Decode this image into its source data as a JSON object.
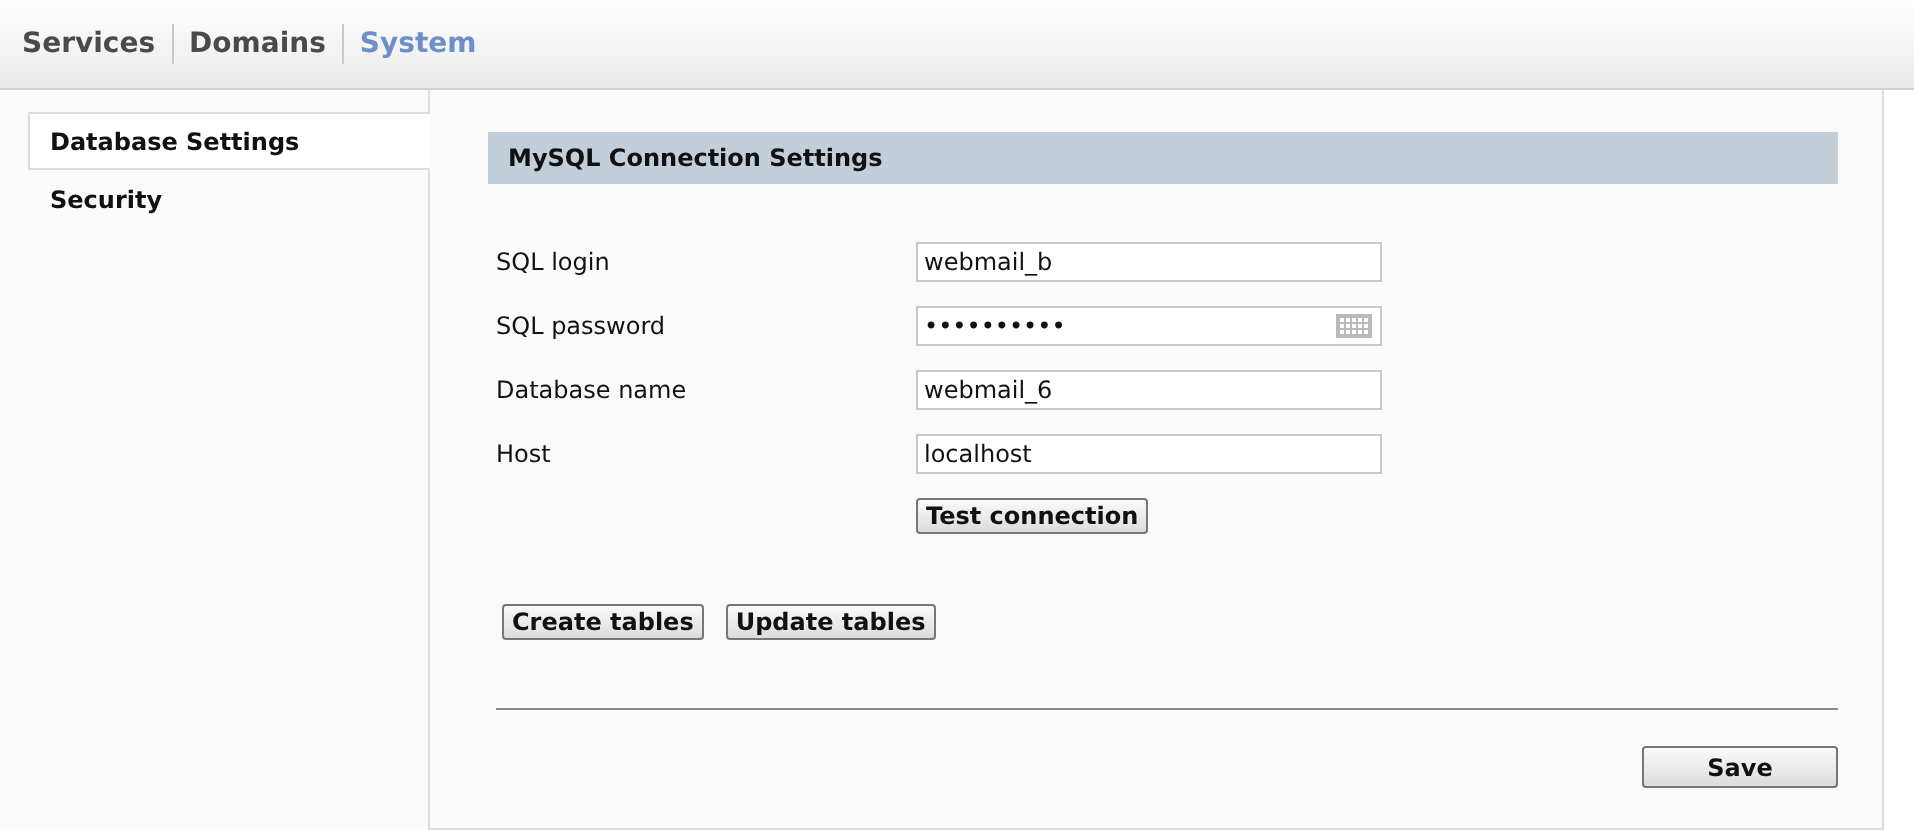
{
  "nav": [
    {
      "label": "Services",
      "selected": false
    },
    {
      "label": "Domains",
      "selected": false
    },
    {
      "label": "System",
      "selected": true
    }
  ],
  "sidebar": {
    "items": [
      {
        "label": "Database Settings",
        "selected": true
      },
      {
        "label": "Security",
        "selected": false
      }
    ]
  },
  "section": {
    "title": "MySQL Connection Settings",
    "fields": [
      {
        "label": "SQL login",
        "value": "webmail_b",
        "kind": "text"
      },
      {
        "label": "SQL password",
        "value": "••••••••••",
        "kind": "password"
      },
      {
        "label": "Database name",
        "value": "webmail_6",
        "kind": "text"
      },
      {
        "label": "Host",
        "value": "localhost",
        "kind": "text"
      }
    ],
    "test_button": "Test connection",
    "table_buttons": [
      "Create tables",
      "Update tables"
    ],
    "save_button": "Save"
  }
}
